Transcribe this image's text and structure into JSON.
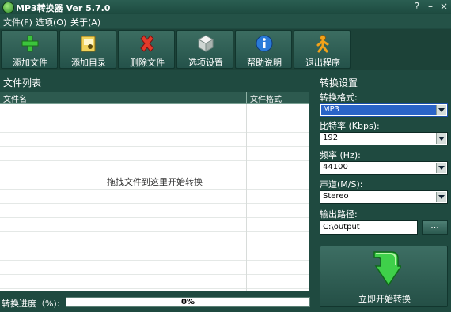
{
  "window": {
    "title": "MP3转换器 Ver 5.7.0",
    "controls": {
      "help": "?",
      "minimize": "–",
      "close": "×"
    }
  },
  "menu": {
    "items": [
      "文件(F)",
      "选项(O)",
      "关于(A)"
    ]
  },
  "toolbar": {
    "buttons": [
      {
        "label": "添加文件",
        "icon": "plus-icon"
      },
      {
        "label": "添加目录",
        "icon": "folder-icon"
      },
      {
        "label": "删除文件",
        "icon": "delete-x-icon"
      },
      {
        "label": "选项设置",
        "icon": "settings-cube-icon"
      },
      {
        "label": "帮助说明",
        "icon": "info-icon"
      },
      {
        "label": "退出程序",
        "icon": "exit-person-icon"
      }
    ]
  },
  "file_list": {
    "title": "文件列表",
    "columns": [
      "文件名",
      "文件格式"
    ],
    "drop_hint": "拖拽文件到这里开始转换"
  },
  "progress": {
    "label": "转换进度（%):",
    "value_text": "0%",
    "value": 0
  },
  "settings": {
    "title": "转换设置",
    "format": {
      "label": "转换格式:",
      "value": "MP3"
    },
    "bitrate": {
      "label": "比特率 (Kbps):",
      "value": "192"
    },
    "frequency": {
      "label": "频率 (Hz):",
      "value": "44100"
    },
    "channel": {
      "label": "声道(M/S):",
      "value": "Stereo"
    },
    "output": {
      "label": "输出路径:",
      "value": "C:\\output",
      "browse_label": "..."
    },
    "start_label": "立即开始转换"
  },
  "colors": {
    "background": "#1f4a40",
    "accent_green": "#3aa060",
    "select_highlight": "#2a64c8"
  }
}
